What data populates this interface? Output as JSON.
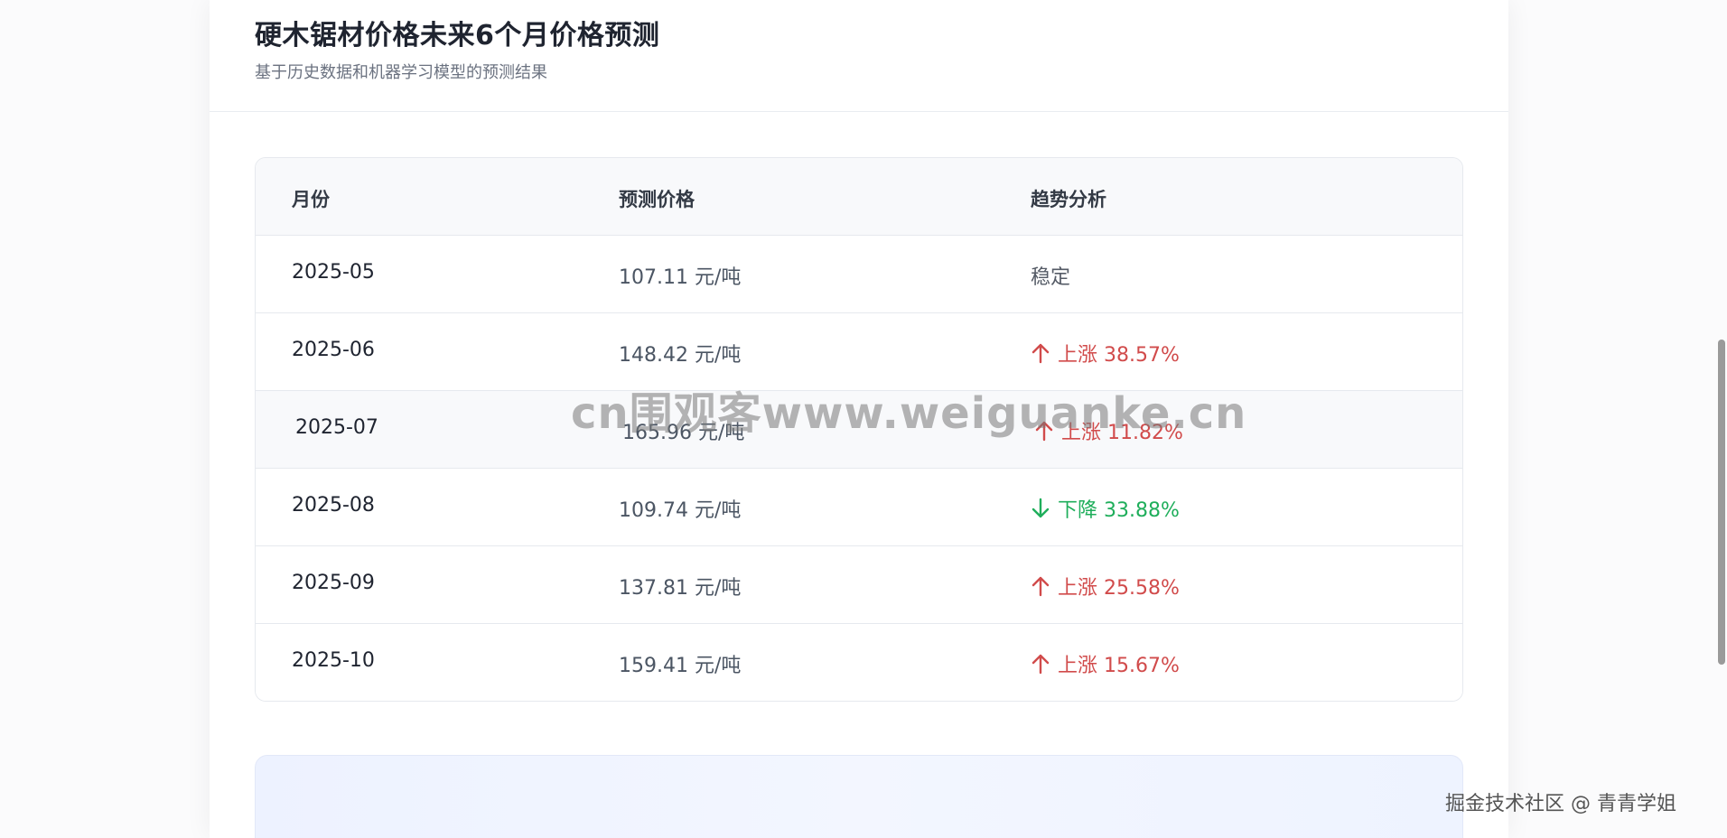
{
  "header": {
    "title": "硬木锯材价格未来6个月价格预测",
    "subtitle": "基于历史数据和机器学习模型的预测结果"
  },
  "table": {
    "columns": [
      "月份",
      "预测价格",
      "趋势分析"
    ],
    "rows": [
      {
        "month": "2025-05",
        "price": "107.11 元/吨",
        "trend": "稳定",
        "direction": "stable"
      },
      {
        "month": "2025-06",
        "price": "148.42 元/吨",
        "trend": "上涨 38.57%",
        "direction": "up"
      },
      {
        "month": "2025-07",
        "price": "165.96 元/吨",
        "trend": "上涨 11.82%",
        "direction": "up"
      },
      {
        "month": "2025-08",
        "price": "109.74 元/吨",
        "trend": "下降 33.88%",
        "direction": "down"
      },
      {
        "month": "2025-09",
        "price": "137.81 元/吨",
        "trend": "上涨 25.58%",
        "direction": "up"
      },
      {
        "month": "2025-10",
        "price": "159.41 元/吨",
        "trend": "上涨 15.67%",
        "direction": "up"
      }
    ]
  },
  "watermark": "cn围观客www.weiguanke.cn",
  "credit": "掘金技术社区 @ 青青学姐",
  "colors": {
    "up": "#d14b4b",
    "down": "#1fae5b",
    "stable": "#555b66"
  }
}
